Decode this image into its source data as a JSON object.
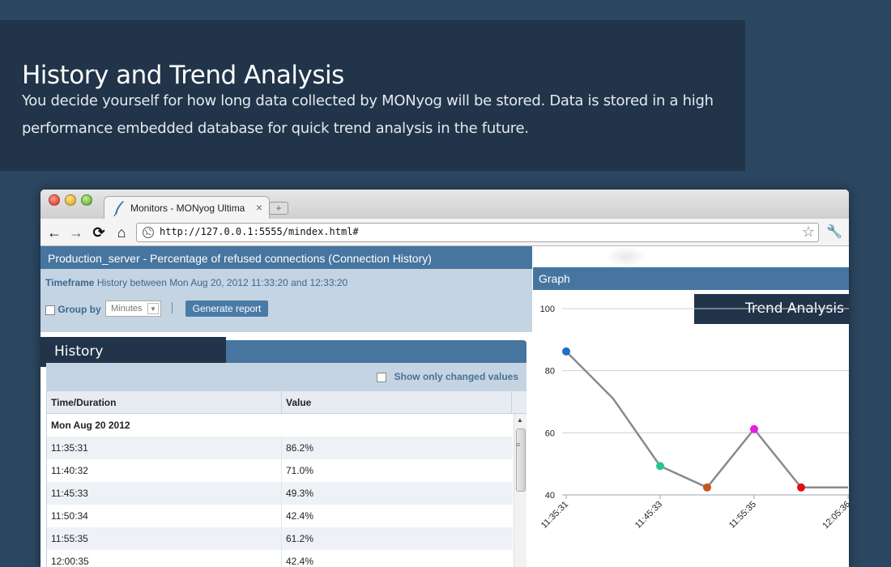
{
  "hero": {
    "title": "History and Trend Analysis",
    "description": "You decide yourself for how long data collected by MONyog will be stored.  Data is stored in a high performance embedded database for quick trend analysis in the future."
  },
  "browser": {
    "tab_title": "Monitors - MONyog Ultima",
    "tab_close": "×",
    "new_tab": "+",
    "url": "http://127.0.0.1:5555/mindex.html#",
    "back": "←",
    "forward": "→",
    "reload": "⟳",
    "home": "⌂",
    "star": "☆",
    "wrench": "🔧"
  },
  "left_panel": {
    "header": "Production_server - Percentage of refused connections (Connection History)",
    "timeframe_label": "Timeframe",
    "timeframe_value": "History between Mon Aug 20, 2012 11:33:20 and 12:33:20",
    "group_by_label": "Group by",
    "group_by_value": "Minutes",
    "generate_button": "Generate report",
    "history_tab": "History",
    "show_changed_label": "Show only changed values",
    "table": {
      "columns": [
        "Time/Duration",
        "Value"
      ],
      "date_row": "Mon Aug 20 2012",
      "rows": [
        {
          "time": "11:35:31",
          "value": "86.2%"
        },
        {
          "time": "11:40:32",
          "value": "71.0%"
        },
        {
          "time": "11:45:33",
          "value": "49.3%"
        },
        {
          "time": "11:50:34",
          "value": "42.4%"
        },
        {
          "time": "11:55:35",
          "value": "61.2%"
        },
        {
          "time": "12:00:35",
          "value": "42.4%"
        }
      ]
    }
  },
  "right_panel": {
    "header": "Graph",
    "trend_tab": "Trend Analysis"
  },
  "chart_data": {
    "type": "line",
    "x": [
      "11:35:31",
      "11:40:32",
      "11:45:33",
      "11:50:34",
      "11:55:35",
      "12:00:35",
      "12:05:36"
    ],
    "y": [
      86.2,
      71.0,
      49.3,
      42.4,
      61.2,
      42.4,
      42.4
    ],
    "tick_labels_x": [
      "11:35:31",
      "11:45:33",
      "11:55:35",
      "12:05:36"
    ],
    "tick_values_y": [
      40,
      60,
      80,
      100
    ],
    "ylim": [
      40,
      100
    ],
    "grid": true,
    "line_color": "#8a8a8a",
    "point_colors": [
      "#1f6fc4",
      null,
      "#2bc48a",
      "#c4561f",
      "#e020e0",
      "#e01010",
      null
    ]
  }
}
